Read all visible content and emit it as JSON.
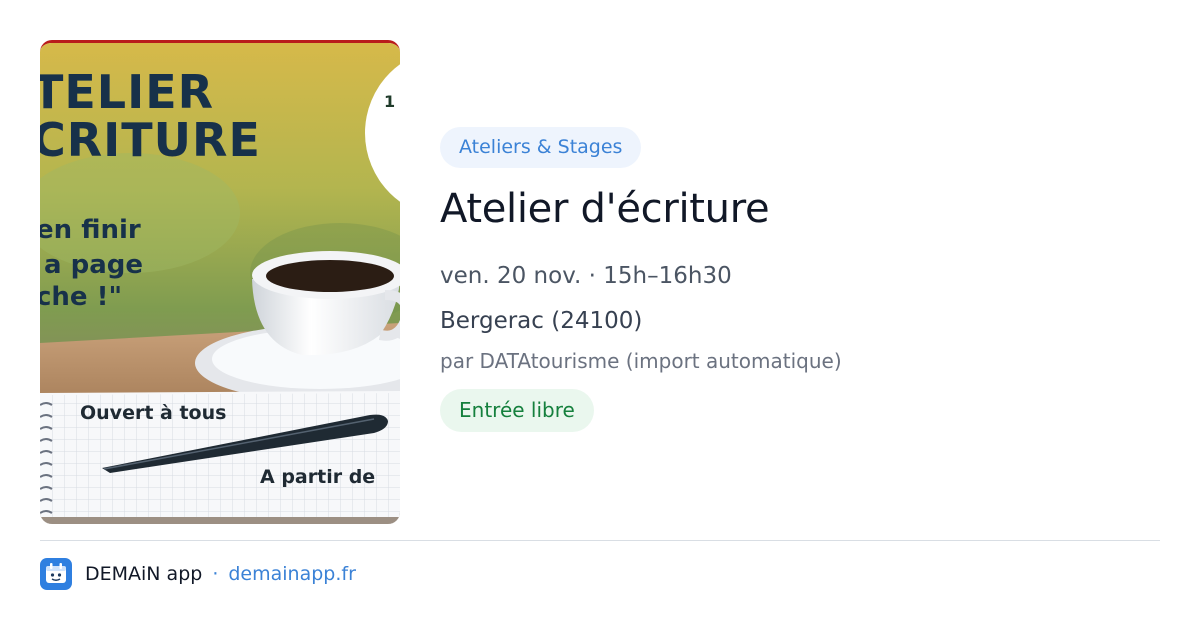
{
  "poster": {
    "title_line1": "TELIER",
    "title_line2": "CRITURE",
    "tagline_line1": "en finir",
    "tagline_line2": "a page",
    "tagline_line3": "che !\"",
    "open_text": "Ouvert à tous",
    "age_text": "A partir de",
    "badge_text": "1"
  },
  "event": {
    "category": "Ateliers & Stages",
    "title": "Atelier d'écriture",
    "datetime": "ven. 20 nov. · 15h–16h30",
    "location": "Bergerac (24100)",
    "source": "par DATAtourisme (import automatique)",
    "price": "Entrée libre"
  },
  "footer": {
    "app_name": "DEMAiN app",
    "separator": "·",
    "domain": "demainapp.fr"
  },
  "colors": {
    "accent_blue": "#3b82d6",
    "category_bg": "#eef4fd",
    "price_green": "#15803d",
    "price_bg": "#eaf7ee",
    "poster_border": "#b91c1c"
  }
}
